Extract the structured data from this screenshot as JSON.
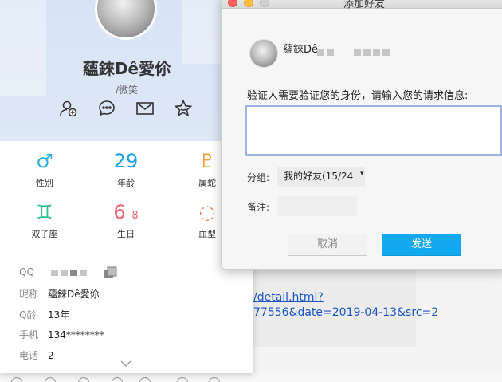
{
  "background": {
    "link_line_1": "/detail.html?",
    "link_line_2": "77556&date=2019-04-13&src=2"
  },
  "profile": {
    "nickname": "蘊錸Dê愛伱",
    "signature": "/微笑",
    "actions": [
      "add-friend-icon",
      "chat-bubble-icon",
      "mail-icon",
      "star-icon"
    ],
    "info": [
      {
        "glyph": "♂",
        "label": "性别",
        "color": "#2ab0e0"
      },
      {
        "glyph": "29",
        "label": "年龄",
        "color": "#1aa0e8"
      },
      {
        "glyph": "♇",
        "label": "属蛇",
        "color": "#f0a030"
      },
      {
        "glyph": "♊",
        "label": "双子座",
        "color": "#30c090"
      },
      {
        "glyph": "6",
        "glyph2": "8",
        "label": "生日",
        "color": "#f06070"
      },
      {
        "glyph": "◌",
        "label": "血型",
        "color": "#f08050"
      }
    ],
    "details": {
      "qq_key": "QQ",
      "nick_key": "昵称",
      "nick_val": "蘊錸Dê愛伱",
      "qage_key": "Q龄",
      "qage_val": "13年",
      "phone_key": "手机",
      "phone_val": "134********",
      "tel_key": "电话",
      "tel_val": "2"
    }
  },
  "dialog": {
    "title": "添加好友",
    "name": "蘊錸Dê",
    "prompt": "验证人需要验证您的身份，请输入您的请求信息:",
    "input_value": "",
    "group_label": "分组:",
    "group_value": "我的好友(15/24",
    "group_caret": "▾",
    "remark_label": "备注:",
    "remark_value": "",
    "cancel": "取消",
    "send": "发送",
    "colors": {
      "send": "#12a9f0",
      "input_border": "#9fb4e3"
    }
  }
}
